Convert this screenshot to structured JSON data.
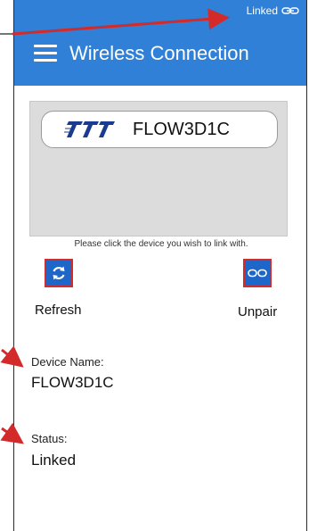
{
  "status_bar": {
    "text": "Linked",
    "icon": "link-icon"
  },
  "app_bar": {
    "title": "Wireless Connection",
    "menu_icon": "hamburger-menu-icon"
  },
  "device_list": {
    "items": [
      {
        "name": "FLOW3D1C",
        "logo": "TTT"
      }
    ],
    "hint": "Please click the device you wish to link with."
  },
  "actions": {
    "refresh_label": "Refresh",
    "unpair_label": "Unpair"
  },
  "details": {
    "device_name_label": "Device Name:",
    "device_name_value": "FLOW3D1C",
    "status_label": "Status:",
    "status_value": "Linked"
  },
  "colors": {
    "primary": "#2f80d6",
    "button": "#1e67c9",
    "highlight_red": "#d32a2a",
    "panel_bg": "#dcdcdc"
  }
}
